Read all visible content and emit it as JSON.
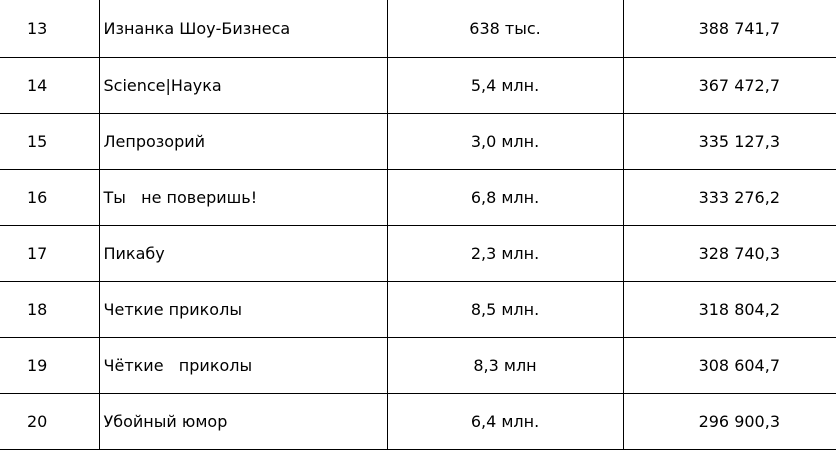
{
  "table": {
    "rows": [
      {
        "rank": "13",
        "name": "Изнанка Шоу-Бизнеса",
        "subscribers": "638 тыс.",
        "value": "388 741,7"
      },
      {
        "rank": "14",
        "name": "Science|Наука",
        "subscribers": "5,4 млн.",
        "value": "367 472,7"
      },
      {
        "rank": "15",
        "name": "Лепрозорий",
        "subscribers": "3,0 млн.",
        "value": "335 127,3"
      },
      {
        "rank": "16",
        "name": "Ты   не поверишь!",
        "subscribers": "6,8 млн.",
        "value": "333 276,2"
      },
      {
        "rank": "17",
        "name": "Пикабу",
        "subscribers": "2,3 млн.",
        "value": "328 740,3"
      },
      {
        "rank": "18",
        "name": "Четкие приколы",
        "subscribers": "8,5 млн.",
        "value": "318 804,2"
      },
      {
        "rank": "19",
        "name": "Чёткие   приколы",
        "subscribers": "8,3 млн",
        "value": "308 604,7"
      },
      {
        "rank": "20",
        "name": "Убойный юмор",
        "subscribers": "6,4 млн.",
        "value": "296 900,3"
      }
    ]
  }
}
